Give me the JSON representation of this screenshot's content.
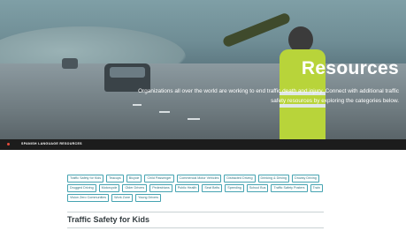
{
  "hero": {
    "title": "Resources",
    "text": "Organizations all over the world are working to end traffic death and injury. Connect with additional traffic safety resources by exploring the categories below."
  },
  "subnav": {
    "label": "SPANISH LANGUAGE RESOURCES"
  },
  "categories": [
    {
      "label": "Traffic Safety for Kids"
    },
    {
      "label": "Teacups"
    },
    {
      "label": "Bicycle"
    },
    {
      "label": "Child Passenger"
    },
    {
      "label": "Commercial Motor Vehicles"
    },
    {
      "label": "Distracted Driving"
    },
    {
      "label": "Drinking & Driving"
    },
    {
      "label": "Drowsy Driving"
    },
    {
      "label": "Drugged Driving"
    },
    {
      "label": "Motorcycle"
    },
    {
      "label": "Older Drivers"
    },
    {
      "label": "Pedestrians"
    },
    {
      "label": "Public Health"
    },
    {
      "label": "Seat Belts"
    },
    {
      "label": "Speeding"
    },
    {
      "label": "School Bus"
    },
    {
      "label": "Traffic Safety Posters"
    },
    {
      "label": "Train"
    },
    {
      "label": "Vision Zero Communities"
    },
    {
      "label": "Work Zone"
    },
    {
      "label": "Young Drivers"
    }
  ],
  "section": {
    "title": "Traffic Safety for Kids"
  },
  "colors": {
    "accent": "#45a3b1",
    "bar": "#1c1c1c"
  }
}
